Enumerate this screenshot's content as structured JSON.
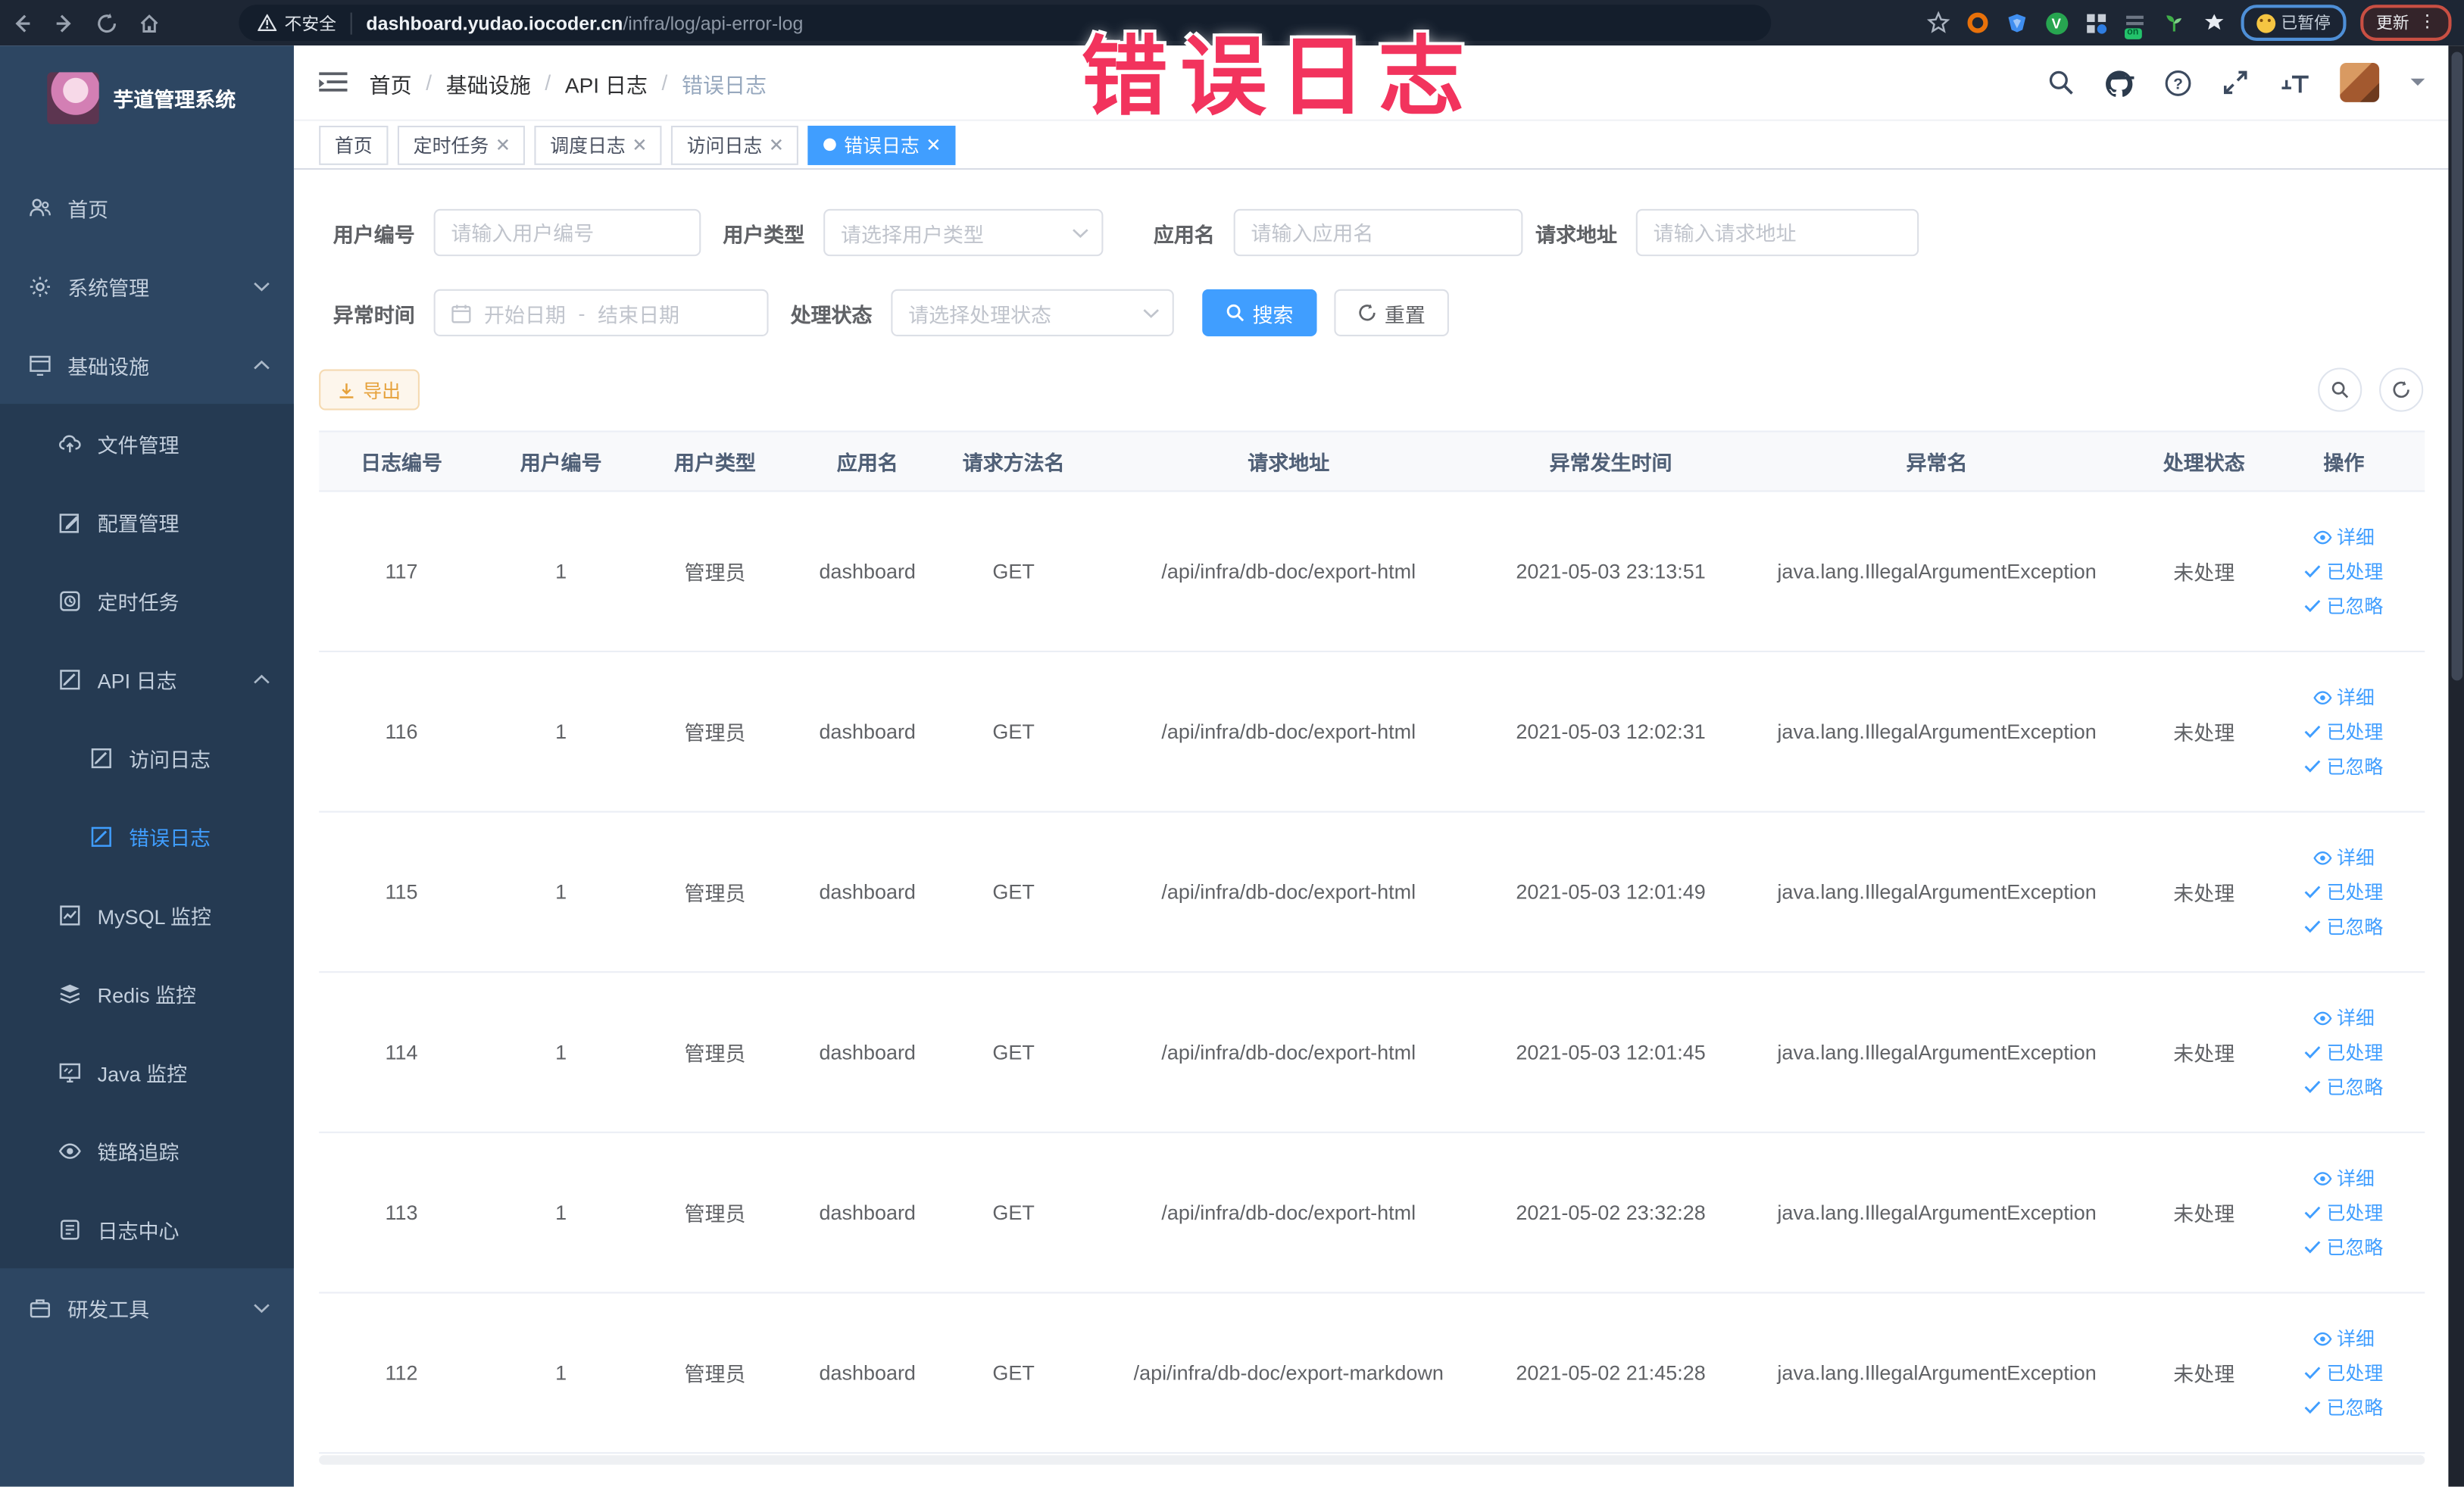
{
  "annotation": {
    "text": "错误日志"
  },
  "browser": {
    "security_label": "不安全",
    "url_domain": "dashboard.yudao.iocoder.cn",
    "url_path": "/infra/log/api-error-log",
    "paused_badge": "已暂停",
    "update_button": "更新",
    "on_badge": "on"
  },
  "sidebar": {
    "title": "芋道管理系统",
    "items": [
      {
        "label": "首页"
      },
      {
        "label": "系统管理"
      },
      {
        "label": "基础设施"
      },
      {
        "label": "文件管理"
      },
      {
        "label": "配置管理"
      },
      {
        "label": "定时任务"
      },
      {
        "label": "API 日志"
      },
      {
        "label": "访问日志"
      },
      {
        "label": "错误日志"
      },
      {
        "label": "MySQL 监控"
      },
      {
        "label": "Redis 监控"
      },
      {
        "label": "Java 监控"
      },
      {
        "label": "链路追踪"
      },
      {
        "label": "日志中心"
      },
      {
        "label": "研发工具"
      }
    ]
  },
  "header": {
    "breadcrumb": [
      "首页",
      "基础设施",
      "API 日志",
      "错误日志"
    ],
    "separator": "/"
  },
  "tabs": [
    {
      "label": "首页"
    },
    {
      "label": "定时任务"
    },
    {
      "label": "调度日志"
    },
    {
      "label": "访问日志"
    },
    {
      "label": "错误日志"
    }
  ],
  "filters": {
    "user_id": {
      "label": "用户编号",
      "placeholder": "请输入用户编号"
    },
    "user_type": {
      "label": "用户类型",
      "placeholder": "请选择用户类型"
    },
    "app_name": {
      "label": "应用名",
      "placeholder": "请输入应用名"
    },
    "request_url": {
      "label": "请求地址",
      "placeholder": "请输入请求地址"
    },
    "exception_time": {
      "label": "异常时间",
      "start_placeholder": "开始日期",
      "separator": "-",
      "end_placeholder": "结束日期"
    },
    "process_status": {
      "label": "处理状态",
      "placeholder": "请选择处理状态"
    },
    "search_button": "搜索",
    "reset_button": "重置"
  },
  "toolbar": {
    "export_button": "导出"
  },
  "table": {
    "headers": [
      "日志编号",
      "用户编号",
      "用户类型",
      "应用名",
      "请求方法名",
      "请求地址",
      "异常发生时间",
      "异常名",
      "处理状态",
      "操作"
    ],
    "rows": [
      {
        "id": "117",
        "user_id": "1",
        "user_type": "管理员",
        "app_name": "dashboard",
        "method": "GET",
        "url": "/api/infra/db-doc/export-html",
        "time": "2021-05-03 23:13:51",
        "exception": "java.lang.IllegalArgumentException",
        "status": "未处理"
      },
      {
        "id": "116",
        "user_id": "1",
        "user_type": "管理员",
        "app_name": "dashboard",
        "method": "GET",
        "url": "/api/infra/db-doc/export-html",
        "time": "2021-05-03 12:02:31",
        "exception": "java.lang.IllegalArgumentException",
        "status": "未处理"
      },
      {
        "id": "115",
        "user_id": "1",
        "user_type": "管理员",
        "app_name": "dashboard",
        "method": "GET",
        "url": "/api/infra/db-doc/export-html",
        "time": "2021-05-03 12:01:49",
        "exception": "java.lang.IllegalArgumentException",
        "status": "未处理"
      },
      {
        "id": "114",
        "user_id": "1",
        "user_type": "管理员",
        "app_name": "dashboard",
        "method": "GET",
        "url": "/api/infra/db-doc/export-html",
        "time": "2021-05-03 12:01:45",
        "exception": "java.lang.IllegalArgumentException",
        "status": "未处理"
      },
      {
        "id": "113",
        "user_id": "1",
        "user_type": "管理员",
        "app_name": "dashboard",
        "method": "GET",
        "url": "/api/infra/db-doc/export-html",
        "time": "2021-05-02 23:32:28",
        "exception": "java.lang.IllegalArgumentException",
        "status": "未处理"
      },
      {
        "id": "112",
        "user_id": "1",
        "user_type": "管理员",
        "app_name": "dashboard",
        "method": "GET",
        "url": "/api/infra/db-doc/export-markdown",
        "time": "2021-05-02 21:45:28",
        "exception": "java.lang.IllegalArgumentException",
        "status": "未处理"
      }
    ],
    "actions": {
      "detail": "详细",
      "processed": "已处理",
      "ignored": "已忽略"
    }
  },
  "colors": {
    "accent": "#409eff",
    "annotation": "#f2335d",
    "warning": "#e6a23c",
    "sidebar_bg": "#2d4662",
    "submenu_bg": "#253a52",
    "tab_active": "#409eff"
  }
}
